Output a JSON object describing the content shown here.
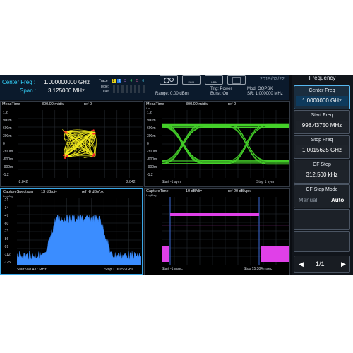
{
  "header": {
    "center_label": "Center Freq :",
    "center_value": "1.000000000 GHz",
    "span_label": "Span :",
    "span_value": "3.125000 MHz",
    "trace_label": "Trace :",
    "trace_numbers": [
      "1",
      "2",
      "3",
      "4",
      "5",
      "6"
    ],
    "type_label": "Type:",
    "det_label": "Det:",
    "range": "Range: 0.00 dBm",
    "trig": "Trig: Power",
    "burst": "Burst: On",
    "mod": "Mod: OQPSK",
    "sr": "SR: 1.000000 MHz",
    "date": "2019/02/22",
    "icon_labels": [
      "DMA",
      "VBA"
    ]
  },
  "panels": {
    "tl": {
      "title": "MeasTime",
      "scale": "300.00 m/div",
      "ref": "ref 0",
      "y_ticks": [
        "1.2",
        "900m",
        "600m",
        "300m",
        "0",
        "-300m",
        "-600m",
        "-900m",
        "-1.2"
      ],
      "x_start": "-2.842",
      "x_end": "2.842"
    },
    "tr": {
      "title": "MeasTime",
      "scale": "300.00 m/div",
      "ref": "ref 0",
      "unit": "Lin",
      "y_ticks": [
        "1.2",
        "900m",
        "600m",
        "300m",
        "0",
        "-300m",
        "-600m",
        "-900m",
        "-1.2"
      ],
      "x_start": "Start -1 sym",
      "x_end": "Stop 1 sym"
    },
    "bl": {
      "title": "CaptureSpectrum",
      "scale": "13 dB/div",
      "ref": "ref -8 dBVpk",
      "unit": "LogMag",
      "y_ticks": [
        "-21",
        "-34",
        "-47",
        "-60",
        "-73",
        "-86",
        "-99",
        "-112",
        "-125"
      ],
      "x_start": "Start 998.437 MHz",
      "x_end": "Stop 1.00156 GHz"
    },
    "br": {
      "title": "CaptureTime",
      "scale": "10 dB/div",
      "ref": "ref 20 dBVpk",
      "unit": "LogMag",
      "x_start": "Start -1 msec",
      "x_end": "Stop 15.384 msec"
    }
  },
  "sidebar": {
    "title": "Frequency",
    "buttons": [
      {
        "label": "Center Freq",
        "value": "1.0000000 GHz"
      },
      {
        "label": "Start Freq",
        "value": "998.43750 MHz"
      },
      {
        "label": "Stop Freq",
        "value": "1.0015625 GHz"
      },
      {
        "label": "CF Step",
        "value": "312.500 kHz"
      }
    ],
    "mode_label": "CF Step Mode",
    "mode_manual": "Manual",
    "mode_auto": "Auto",
    "page": "1/1"
  },
  "colors": {
    "accent": "#34d6ff",
    "constellation": "#f5ee1e",
    "eye": "#45d12a",
    "spectrum": "#3b8dff",
    "capture": "#e040e8",
    "selected_border": "#3aa7e6"
  }
}
